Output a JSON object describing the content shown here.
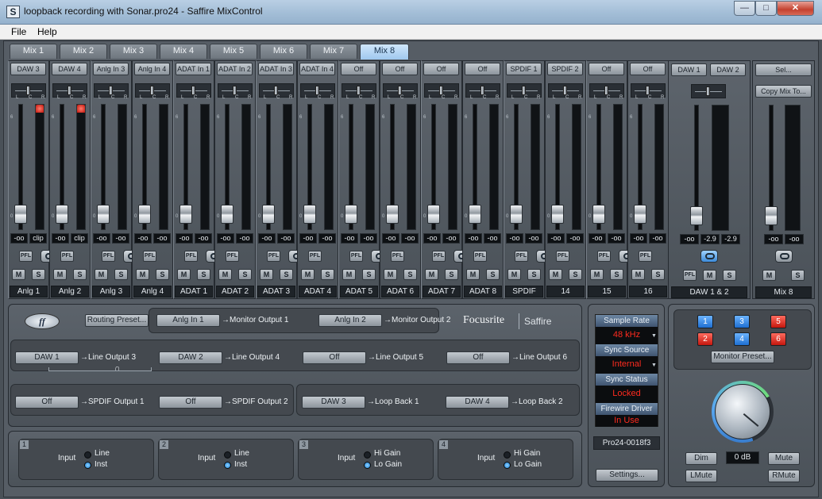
{
  "window": {
    "title": "loopback recording with Sonar.pro24 - Saffire MixControl",
    "minimize": "—",
    "maximize": "□",
    "close": "✕",
    "app_icon": "S"
  },
  "menu": [
    {
      "label": "File"
    },
    {
      "label": "Help"
    }
  ],
  "tabs": [
    {
      "label": "Mix 1"
    },
    {
      "label": "Mix 2"
    },
    {
      "label": "Mix 3"
    },
    {
      "label": "Mix 4"
    },
    {
      "label": "Mix 5"
    },
    {
      "label": "Mix 6"
    },
    {
      "label": "Mix 7"
    },
    {
      "label": "Mix 8",
      "active": true
    }
  ],
  "pan_labels": {
    "l": "L",
    "c": "C",
    "r": "R"
  },
  "scale_labels": {
    "top": "6",
    "mid": "0"
  },
  "channels": [
    {
      "source": "DAW 3",
      "label": "Anlg 1",
      "readout_l": "-oo",
      "readout_r": "clip",
      "clip": true
    },
    {
      "source": "DAW 4",
      "label": "Anlg 2",
      "readout_l": "-oo",
      "readout_r": "clip",
      "clip": true
    },
    {
      "source": "Anlg In 3",
      "label": "Anlg 3",
      "readout_l": "-oo",
      "readout_r": "-oo"
    },
    {
      "source": "Anlg In 4",
      "label": "Anlg 4",
      "readout_l": "-oo",
      "readout_r": "-oo"
    },
    {
      "source": "ADAT In 1",
      "label": "ADAT 1",
      "readout_l": "-oo",
      "readout_r": "-oo"
    },
    {
      "source": "ADAT In 2",
      "label": "ADAT 2",
      "readout_l": "-oo",
      "readout_r": "-oo"
    },
    {
      "source": "ADAT In 3",
      "label": "ADAT 3",
      "readout_l": "-oo",
      "readout_r": "-oo"
    },
    {
      "source": "ADAT In 4",
      "label": "ADAT 4",
      "readout_l": "-oo",
      "readout_r": "-oo"
    },
    {
      "source": "Off",
      "label": "ADAT 5",
      "readout_l": "-oo",
      "readout_r": "-oo"
    },
    {
      "source": "Off",
      "label": "ADAT 6",
      "readout_l": "-oo",
      "readout_r": "-oo"
    },
    {
      "source": "Off",
      "label": "ADAT 7",
      "readout_l": "-oo",
      "readout_r": "-oo"
    },
    {
      "source": "Off",
      "label": "ADAT 8",
      "readout_l": "-oo",
      "readout_r": "-oo"
    },
    {
      "source": "SPDIF 1",
      "label": "SPDIF",
      "readout_l": "-oo",
      "readout_r": "-oo"
    },
    {
      "source": "SPDIF 2",
      "label": "14",
      "readout_l": "-oo",
      "readout_r": "-oo"
    },
    {
      "source": "Off",
      "label": "15",
      "readout_l": "-oo",
      "readout_r": "-oo"
    },
    {
      "source": "Off",
      "label": "16",
      "readout_l": "-oo",
      "readout_r": "-oo"
    }
  ],
  "channel_buttons": {
    "pfl": "PFL",
    "mute": "M",
    "solo": "S"
  },
  "daw_strip": {
    "source_l": "DAW 1",
    "source_r": "DAW 2",
    "readout_1": "-oo",
    "readout_2": "-2.9",
    "readout_3": "-2.9",
    "label": "DAW 1 & 2"
  },
  "master_strip": {
    "select": "Sel...",
    "copy": "Copy Mix To...",
    "readout_l": "-oo",
    "readout_r": "-oo",
    "label": "Mix 8"
  },
  "routing": {
    "logo": "ff",
    "preset_button": "Routing Preset...",
    "brand": "Focusrite",
    "brand2": "Saffire",
    "monitor": [
      {
        "src": "Anlg In 1",
        "dest": "→Monitor Output 1"
      },
      {
        "src": "Anlg In 2",
        "dest": "→Monitor Output 2"
      }
    ],
    "line": [
      {
        "src": "DAW 1",
        "dest": "→Line Output 3"
      },
      {
        "src": "DAW 2",
        "dest": "→Line Output 4"
      },
      {
        "src": "Off",
        "dest": "→Line Output 5"
      },
      {
        "src": "Off",
        "dest": "→Line Output 6"
      }
    ],
    "spdif": [
      {
        "src": "Off",
        "dest": "→SPDIF Output 1"
      },
      {
        "src": "Off",
        "dest": "→SPDIF Output 2"
      }
    ],
    "loopback": [
      {
        "src": "DAW 3",
        "dest": "→Loop Back 1"
      },
      {
        "src": "DAW 4",
        "dest": "→Loop Back 2"
      }
    ]
  },
  "inputs": [
    {
      "num": "1",
      "label": "Input",
      "opt1": "Line",
      "opt2": "Inst",
      "selected": 2
    },
    {
      "num": "2",
      "label": "Input",
      "opt1": "Line",
      "opt2": "Inst",
      "selected": 2
    },
    {
      "num": "3",
      "label": "Input",
      "opt1": "Hi Gain",
      "opt2": "Lo Gain",
      "selected": 2
    },
    {
      "num": "4",
      "label": "Input",
      "opt1": "Hi Gain",
      "opt2": "Lo Gain",
      "selected": 2
    }
  ],
  "status": {
    "sample_rate_label": "Sample Rate",
    "sample_rate": "48 kHz",
    "sync_source_label": "Sync Source",
    "sync_source": "Internal",
    "sync_status_label": "Sync Status",
    "sync_status": "Locked",
    "firewire_label": "Firewire Driver",
    "firewire": "In Use",
    "device": "Pro24-0018f3",
    "settings_button": "Settings..."
  },
  "monitor": {
    "buttons": [
      {
        "label": "1",
        "color": "blue"
      },
      {
        "label": "3",
        "color": "blue"
      },
      {
        "label": "5",
        "color": "red"
      },
      {
        "label": "2",
        "color": "red"
      },
      {
        "label": "4",
        "color": "blue"
      },
      {
        "label": "6",
        "color": "red"
      }
    ],
    "preset_button": "Monitor Preset...",
    "level": "0 dB",
    "dim": "Dim",
    "mute": "Mute",
    "lmute": "LMute",
    "rmute": "RMute"
  },
  "colors": {
    "accent": "#5aa8f0",
    "alert": "#ff2b1f",
    "knob_ring": "#6fdc7a"
  }
}
